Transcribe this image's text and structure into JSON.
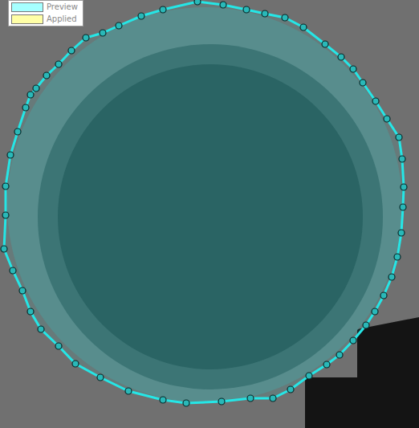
{
  "legend": [
    {
      "label": "Preview",
      "color": "#a6ffff",
      "selected": true
    },
    {
      "label": "Applied",
      "color": "#ffffa6",
      "selected": false
    }
  ]
}
